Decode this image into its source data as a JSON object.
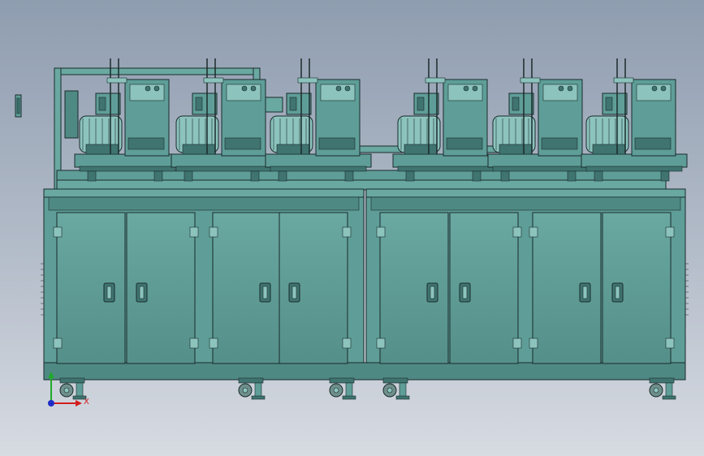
{
  "viewport": {
    "background_top": "#8f9db0",
    "background_bottom": "#d7dbe2"
  },
  "machine": {
    "body_color": "#5f9e98",
    "dark_color": "#3f7470",
    "light_color": "#8cc3bd",
    "line_color": "#1a2b2b",
    "station_count": 6,
    "cabinet_door_count": 8
  },
  "triad": {
    "x_label": "X",
    "x_color": "#d21e1e",
    "y_color": "#1faa2a",
    "z_color": "#1e2cc8"
  }
}
